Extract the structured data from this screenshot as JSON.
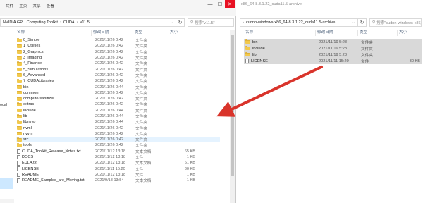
{
  "left_window": {
    "ribbon_tabs": [
      "文件",
      "主页",
      "共享",
      "查看"
    ],
    "controls": [
      "—",
      "☐",
      "✕"
    ],
    "breadcrumb": [
      "NVIDIA GPU Computing Toolkit",
      "CUDA",
      "v11.5"
    ],
    "search_placeholder": "搜索\"v11.5\"",
    "nav_label": "ocal",
    "columns": {
      "name": "名称",
      "date": "修改日期",
      "type": "类型",
      "size": "大小"
    },
    "files": [
      {
        "name": "0_Simple",
        "date": "2021/11/26 0:42",
        "type": "文件夹",
        "size": "",
        "kind": "folder"
      },
      {
        "name": "1_Utilities",
        "date": "2021/11/26 0:42",
        "type": "文件夹",
        "size": "",
        "kind": "folder"
      },
      {
        "name": "2_Graphics",
        "date": "2021/11/26 0:42",
        "type": "文件夹",
        "size": "",
        "kind": "folder"
      },
      {
        "name": "3_Imaging",
        "date": "2021/11/26 0:42",
        "type": "文件夹",
        "size": "",
        "kind": "folder"
      },
      {
        "name": "4_Finance",
        "date": "2021/11/26 0:42",
        "type": "文件夹",
        "size": "",
        "kind": "folder"
      },
      {
        "name": "5_Simulations",
        "date": "2021/11/26 0:42",
        "type": "文件夹",
        "size": "",
        "kind": "folder"
      },
      {
        "name": "6_Advanced",
        "date": "2021/11/26 0:42",
        "type": "文件夹",
        "size": "",
        "kind": "folder"
      },
      {
        "name": "7_CUDALibraries",
        "date": "2021/11/26 0:42",
        "type": "文件夹",
        "size": "",
        "kind": "folder"
      },
      {
        "name": "bin",
        "date": "2021/11/26 0:44",
        "type": "文件夹",
        "size": "",
        "kind": "folder"
      },
      {
        "name": "common",
        "date": "2021/11/26 0:42",
        "type": "文件夹",
        "size": "",
        "kind": "folder"
      },
      {
        "name": "compute-sanitizer",
        "date": "2021/11/26 0:42",
        "type": "文件夹",
        "size": "",
        "kind": "folder"
      },
      {
        "name": "extras",
        "date": "2021/11/26 0:42",
        "type": "文件夹",
        "size": "",
        "kind": "folder"
      },
      {
        "name": "include",
        "date": "2021/11/26 0:44",
        "type": "文件夹",
        "size": "",
        "kind": "folder"
      },
      {
        "name": "lib",
        "date": "2021/11/26 0:44",
        "type": "文件夹",
        "size": "",
        "kind": "folder"
      },
      {
        "name": "libnvvp",
        "date": "2021/11/26 0:44",
        "type": "文件夹",
        "size": "",
        "kind": "folder"
      },
      {
        "name": "nvml",
        "date": "2021/11/26 0:42",
        "type": "文件夹",
        "size": "",
        "kind": "folder"
      },
      {
        "name": "nvvm",
        "date": "2021/11/26 0:42",
        "type": "文件夹",
        "size": "",
        "kind": "folder"
      },
      {
        "name": "src",
        "date": "2021/11/26 0:42",
        "type": "文件夹",
        "size": "",
        "kind": "folder"
      },
      {
        "name": "tools",
        "date": "2021/11/26 0:42",
        "type": "文件夹",
        "size": "",
        "kind": "folder"
      },
      {
        "name": "CUDA_Toolkit_Release_Notes.txt",
        "date": "2021/11/12 13:18",
        "type": "文本文档",
        "size": "65 KB",
        "kind": "file"
      },
      {
        "name": "DOCS",
        "date": "2021/11/12 13:18",
        "type": "文件",
        "size": "1 KB",
        "kind": "file"
      },
      {
        "name": "EULA.txt",
        "date": "2021/11/12 13:18",
        "type": "文本文档",
        "size": "61 KB",
        "kind": "file"
      },
      {
        "name": "LICENSE",
        "date": "2021/11/11 15:20",
        "type": "文件",
        "size": "30 KB",
        "kind": "file"
      },
      {
        "name": "README",
        "date": "2021/11/12 13:18",
        "type": "文件",
        "size": "1 KB",
        "kind": "file"
      },
      {
        "name": "README_Samples_are_Moving.txt",
        "date": "2021/9/18 13:54",
        "type": "文本文档",
        "size": "1 KB",
        "kind": "file"
      }
    ]
  },
  "right_window": {
    "title": "x86_64-8.3.1.22_cuda11.5-archive",
    "breadcrumb": "cudnn-windows-x86_64-8.3.1.22_cuda11.5-archive",
    "search_placeholder": "搜索\"cudnn-windows-x86_64...",
    "columns": {
      "name": "名称",
      "date": "修改日期",
      "type": "类型",
      "size": "大小"
    },
    "files": [
      {
        "name": "bin",
        "date": "2021/11/19 5:28",
        "type": "文件夹",
        "size": "",
        "kind": "folder"
      },
      {
        "name": "include",
        "date": "2021/11/19 5:28",
        "type": "文件夹",
        "size": "",
        "kind": "folder"
      },
      {
        "name": "lib",
        "date": "2021/11/19 5:28",
        "type": "文件夹",
        "size": "",
        "kind": "folder"
      },
      {
        "name": "LICENSE",
        "date": "2021/11/11 15:20",
        "type": "文件",
        "size": "30 KB",
        "kind": "file"
      }
    ]
  },
  "annotation": {
    "arrow_color": "#d9342b"
  },
  "colors": {
    "folder": "#f2c94c",
    "selection": "#d9d9d9",
    "close": "#e81123"
  }
}
